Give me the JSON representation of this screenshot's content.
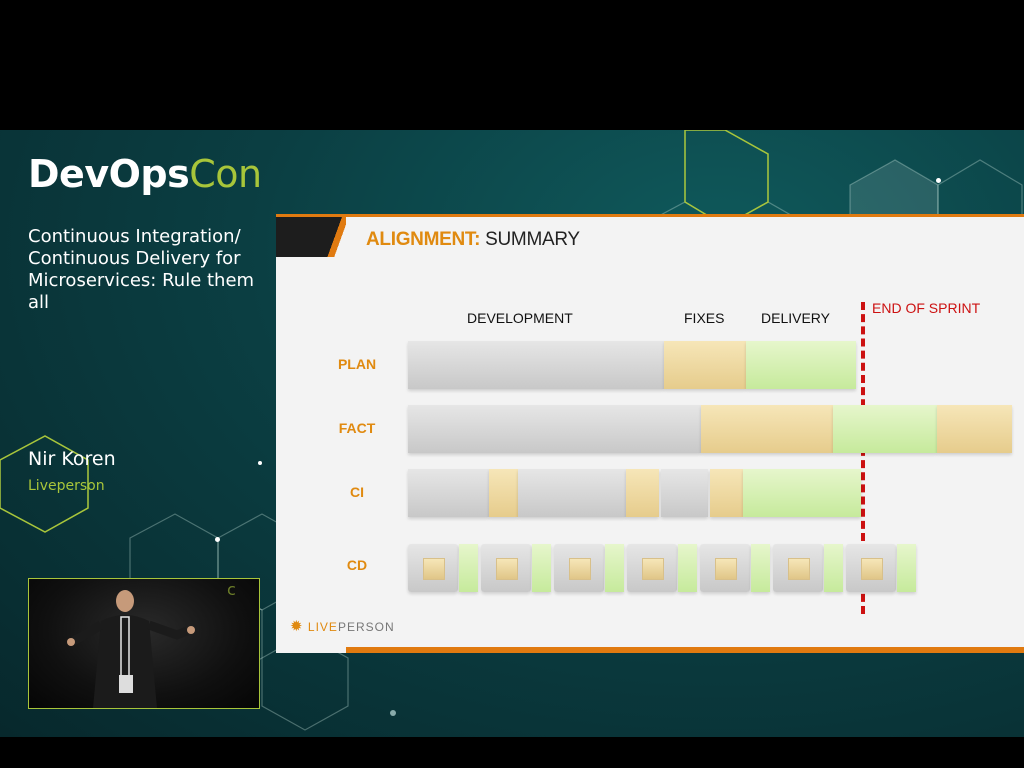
{
  "conference": {
    "logo_primary": "DevOps",
    "logo_accent": "Con",
    "accent_color": "#a8c53a"
  },
  "talk": {
    "title": "Continuous Integration/ Continuous Delivery for Microservices: Rule them all",
    "speaker": "Nir Koren",
    "company": "Liveperson"
  },
  "slide": {
    "heading_accent": "ALIGNMENT:",
    "heading_rest": " SUMMARY",
    "phases": [
      "DEVELOPMENT",
      "FIXES",
      "DELIVERY"
    ],
    "end_of_sprint": "END OF SPRINT",
    "rows": [
      "PLAN",
      "FACT",
      "CI",
      "CD"
    ],
    "brand_live": "LIVE",
    "brand_person": "PERSON",
    "colors": {
      "orange": "#e08a10",
      "sprint_red": "#cc1111",
      "development": "#d4d4d4",
      "fixes": "#eed9a0",
      "delivery": "#d6f0b4"
    }
  }
}
